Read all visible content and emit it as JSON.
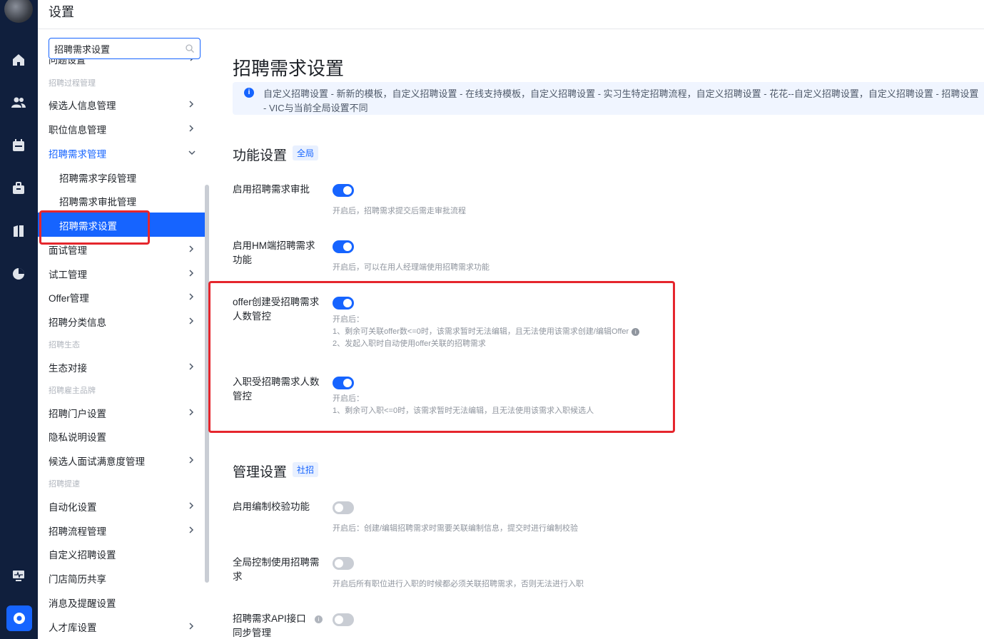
{
  "header": {
    "title": "设置"
  },
  "rail": {
    "icons": [
      "home-icon",
      "users-icon",
      "calendar-icon",
      "briefcase-icon",
      "book-icon",
      "pie-chart-icon",
      "monitor-icon",
      "settings-icon"
    ]
  },
  "sidebar": {
    "search": {
      "value": "招聘需求设置",
      "placeholder": ""
    },
    "partial_item": "问题设置",
    "groups": {
      "g1": "招聘过程管理",
      "g2": "招聘生态",
      "g3": "招聘雇主品牌",
      "g4": "招聘提速"
    },
    "items": {
      "candidate_info": "候选人信息管理",
      "position_info": "职位信息管理",
      "req_mgmt": "招聘需求管理",
      "req_field": "招聘需求字段管理",
      "req_approval": "招聘需求审批管理",
      "req_settings": "招聘需求设置",
      "interview": "面试管理",
      "probation": "试工管理",
      "offer": "Offer管理",
      "category": "招聘分类信息",
      "eco": "生态对接",
      "portal": "招聘门户设置",
      "privacy": "隐私说明设置",
      "satisfaction": "候选人面试满意度管理",
      "automation": "自动化设置",
      "process": "招聘流程管理",
      "custom": "自定义招聘设置",
      "store_share": "门店简历共享",
      "notify": "消息及提醒设置",
      "talent": "人才库设置"
    }
  },
  "main": {
    "title": "招聘需求设置",
    "info": "自定义招聘设置 - 新新的模板，自定义招聘设置 - 在线支持模板，自定义招聘设置 - 实习生特定招聘流程，自定义招聘设置 - 花花--自定义招聘设置，自定义招聘设置 - 招聘设置 - VIC与当前全局设置不同",
    "section1": {
      "title": "功能设置",
      "tag": "全局"
    },
    "section2": {
      "title": "管理设置",
      "tag": "社招"
    },
    "settings": {
      "s1": {
        "name": "启用招聘需求审批",
        "on": true,
        "desc": [
          "开启后，招聘需求提交后需走审批流程"
        ]
      },
      "s2": {
        "name": "启用HM端招聘需求功能",
        "on": true,
        "desc": [
          "开启后，可以在用人经理端使用招聘需求功能"
        ]
      },
      "s3": {
        "name": "offer创建受招聘需求人数管控",
        "on": true,
        "desc": [
          "开启后：",
          "1、剩余可关联offer数<=0时，该需求暂时无法编辑，且无法使用该需求创建/编辑Offer",
          "2、发起入职时自动使用offer关联的招聘需求"
        ]
      },
      "s4": {
        "name": "入职受招聘需求人数管控",
        "on": true,
        "desc": [
          "开启后：",
          "1、剩余可入职<=0时，该需求暂时无法编辑，且无法使用该需求入职候选人"
        ]
      },
      "s5": {
        "name": "启用编制校验功能",
        "on": false,
        "desc": [
          "开启后：创建/编辑招聘需求时需要关联编制信息，提交时进行编制校验"
        ]
      },
      "s6": {
        "name": "全局控制使用招聘需求",
        "on": false,
        "desc": [
          "开启后所有职位进行入职的时候都必须关联招聘需求，否则无法进行入职"
        ]
      },
      "s7": {
        "name": "招聘需求API接口同步管理",
        "on": false,
        "desc": []
      }
    }
  },
  "colors": {
    "primary": "#1664ff",
    "rail": "#101f3d",
    "highlight": "#e5262d"
  }
}
